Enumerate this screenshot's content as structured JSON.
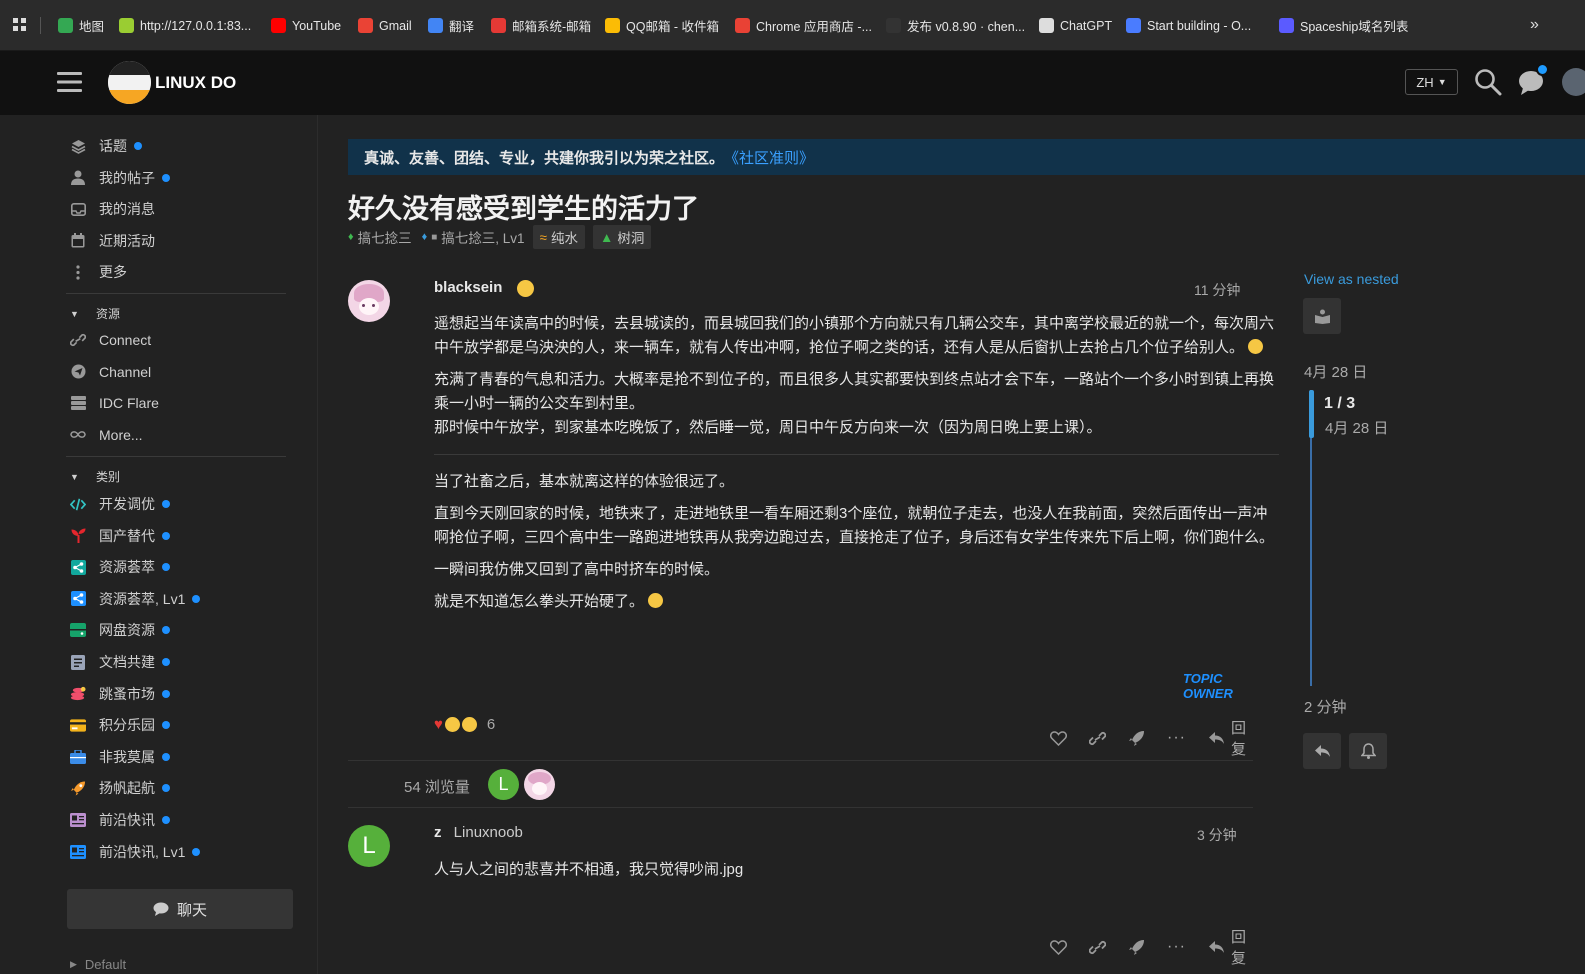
{
  "bookmarks": [
    {
      "label": "地图",
      "color": "#34a853"
    },
    {
      "label": "http://127.0.0.1:83...",
      "color": "#9acd32"
    },
    {
      "label": "YouTube",
      "color": "#ff0000"
    },
    {
      "label": "Gmail",
      "color": "#ea4335"
    },
    {
      "label": "翻译",
      "color": "#4285f4"
    },
    {
      "label": "邮箱系统-邮箱",
      "color": "#e53935"
    },
    {
      "label": "QQ邮箱 - 收件箱",
      "color": "#fbbc05"
    },
    {
      "label": "Chrome 应用商店 -...",
      "color": "#e94235"
    },
    {
      "label": "发布 v0.8.90 · chen...",
      "color": "#333333"
    },
    {
      "label": "ChatGPT",
      "color": "#dddddd"
    },
    {
      "label": "Start building - O...",
      "color": "#4a7cff"
    },
    {
      "label": "Spaceship域名列表",
      "color": "#5b5bff"
    }
  ],
  "header": {
    "site_name": "LINUX DO",
    "lang": "ZH"
  },
  "sidebar": {
    "top_items": [
      {
        "label": "话题",
        "icon": "layers-icon",
        "dot": true
      },
      {
        "label": "我的帖子",
        "icon": "user-icon",
        "dot": true
      },
      {
        "label": "我的消息",
        "icon": "inbox-icon",
        "dot": false
      },
      {
        "label": "近期活动",
        "icon": "calendar-icon",
        "dot": false
      },
      {
        "label": "更多",
        "icon": "ellipsis-v-icon",
        "dot": false
      }
    ],
    "resources_title": "资源",
    "resources": [
      {
        "label": "Connect",
        "icon": "link-icon"
      },
      {
        "label": "Channel",
        "icon": "send-icon"
      },
      {
        "label": "IDC Flare",
        "icon": "server-icon"
      },
      {
        "label": "More...",
        "icon": "infinity-icon"
      }
    ],
    "categories_title": "类别",
    "categories": [
      {
        "label": "开发调优",
        "color": "#32c3c3",
        "icon": "code-icon"
      },
      {
        "label": "国产替代",
        "color": "#e5262d",
        "icon": "sprout-icon"
      },
      {
        "label": "资源荟萃",
        "color": "#12a89d",
        "icon": "share-icon"
      },
      {
        "label": "资源荟萃, Lv1",
        "color": "#1e90ff",
        "icon": "share-icon"
      },
      {
        "label": "网盘资源",
        "color": "#16a36a",
        "icon": "drive-icon"
      },
      {
        "label": "文档共建",
        "color": "#9aa4b8",
        "icon": "book-icon"
      },
      {
        "label": "跳蚤市场",
        "color": "#f04e6b",
        "icon": "coins-icon"
      },
      {
        "label": "积分乐园",
        "color": "#f3b21b",
        "icon": "card-icon"
      },
      {
        "label": "非我莫属",
        "color": "#3b8ce8",
        "icon": "briefcase-icon"
      },
      {
        "label": "扬帆起航",
        "color": "#f59a2c",
        "icon": "rocket-icon"
      },
      {
        "label": "前沿快讯",
        "color": "#bb8fce",
        "icon": "news-icon"
      },
      {
        "label": "前沿快讯, Lv1",
        "color": "#1e90ff",
        "icon": "news-icon"
      }
    ],
    "chat_label": "聊天",
    "footer_label": "Default"
  },
  "banner": {
    "text": "真诚、友善、团结、专业，共建你我引以为荣之社区。",
    "link": "《社区准则》"
  },
  "topic": {
    "title": "好久没有感受到学生的活力了",
    "category1": "搞七捻三",
    "category2": "搞七捻三, Lv1",
    "tag1": "纯水",
    "tag2": "树洞"
  },
  "post1": {
    "username": "blacksein",
    "time": "11 分钟",
    "paragraphs": [
      "遥想起当年读高中的时候，去县城读的，而县城回我们的小镇那个方向就只有几辆公交车，其中离学校最近的就一个，每次周六中午放学都是乌泱泱的人，来一辆车，就有人传出冲啊，抢位子啊之类的话，还有人是从后窗扒上去抢占几个位子给别人。",
      "充满了青春的气息和活力。大概率是抢不到位子的，而且很多人其实都要快到终点站才会下车，一路站个一个多小时到镇上再换乘一小时一辆的公交车到村里。",
      "那时候中午放学，到家基本吃晚饭了，然后睡一觉，周日中午反方向来一次（因为周日晚上要上课）。",
      "当了社畜之后，基本就离这样的体验很远了。",
      "直到今天刚回家的时候，地铁来了，走进地铁里一看车厢还剩3个座位，就朝位子走去，也没人在我前面，突然后面传出一声冲啊抢位子啊，三四个高中生一路跑进地铁再从我旁边跑过去，直接抢走了位子，身后还有女学生传来先下后上啊，你们跑什么。",
      "一瞬间我仿佛又回到了高中时挤车的时候。",
      "就是不知道怎么拳头开始硬了。"
    ],
    "owner_label": "TOPIC OWNER",
    "reactions_count": "6",
    "reply_label": "回复",
    "views": "54 浏览量"
  },
  "post2": {
    "display_name": "z",
    "username": "Linuxnoob",
    "avatar_letter": "L",
    "time": "3 分钟",
    "text": "人与人之间的悲喜并不相通，我只觉得吵闹.jpg",
    "reply_label": "回复"
  },
  "timeline": {
    "view_nested": "View as nested",
    "start_date": "4月 28 日",
    "progress": "1 / 3",
    "progress_date": "4月 28 日",
    "end_time": "2 分钟"
  }
}
